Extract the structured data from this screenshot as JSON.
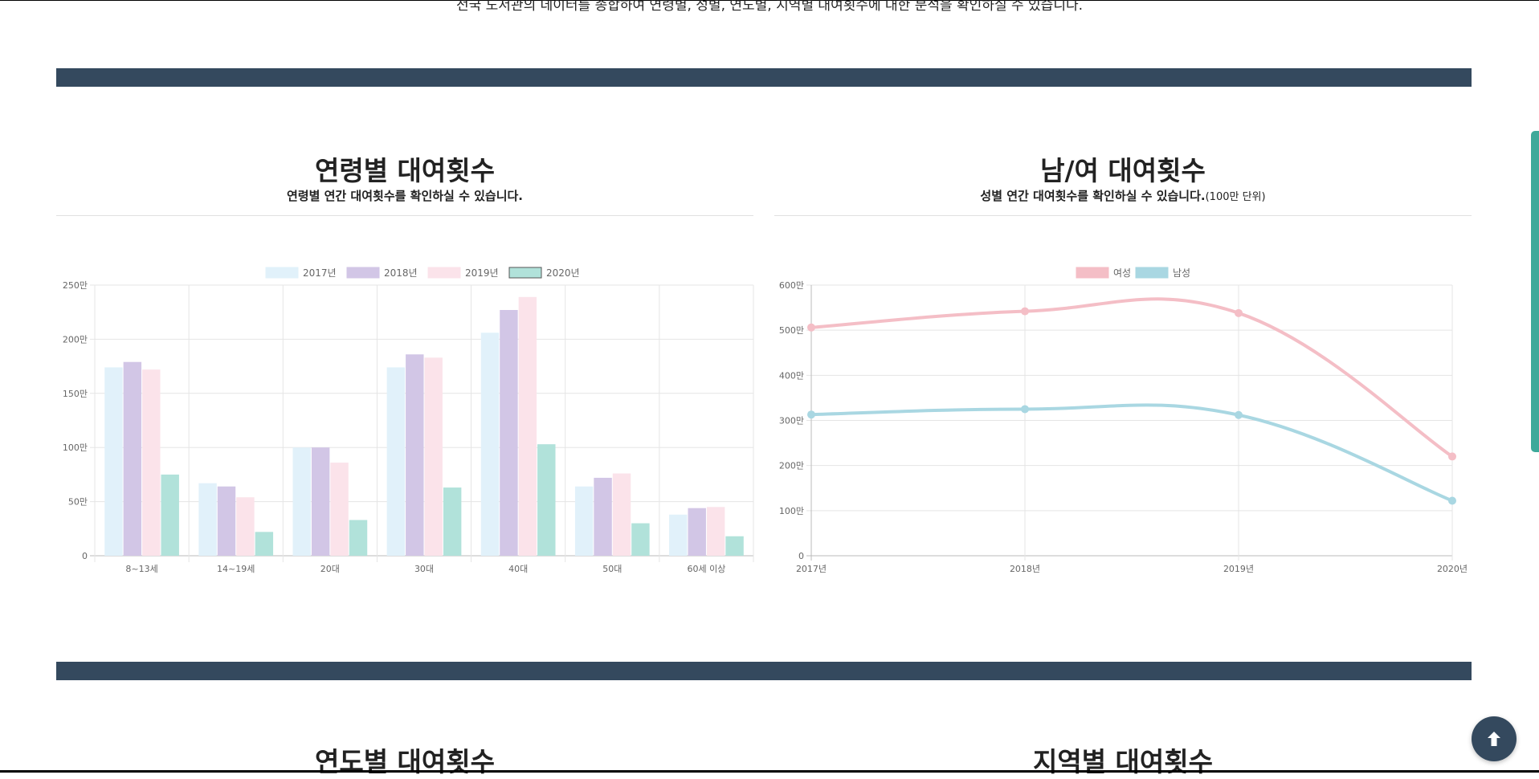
{
  "page": {
    "intro_text": "전국 도서관의 데이터를 종합하여 연령별, 성별, 연도별, 지역별 대여횟수에 대한 분석을 확인하실 수 있습니다."
  },
  "age_section": {
    "title": "연령별 대여횟수",
    "subtitle": "연령별 연간 대여횟수를 확인하실 수 있습니다."
  },
  "gender_section": {
    "title": "남/여 대여횟수",
    "subtitle": "성별 연간 대여횟수를 확인하실 수 있습니다.",
    "unit_note": "(100만 단위)"
  },
  "bottom_sections": {
    "left_title": "연도별 대여횟수",
    "right_title": "지역별 대여횟수"
  },
  "colors": {
    "band": "#34495e",
    "accent": "#3ea99a"
  },
  "icons": {
    "top_button": "arrow-up-icon"
  },
  "chart_data": [
    {
      "type": "bar",
      "categories": [
        "8~13세",
        "14~19세",
        "20대",
        "30대",
        "40대",
        "50대",
        "60세 이상"
      ],
      "series": [
        {
          "name": "2017년",
          "color": "#e1f1fa",
          "border": "#e1f1fa",
          "values": [
            1740000,
            670000,
            1000000,
            1740000,
            2060000,
            640000,
            380000
          ]
        },
        {
          "name": "2018년",
          "color": "#d2c6e6",
          "border": "#d2c6e6",
          "values": [
            1790000,
            640000,
            1000000,
            1860000,
            2270000,
            720000,
            440000
          ]
        },
        {
          "name": "2019년",
          "color": "#fbe3ea",
          "border": "#fbe3ea",
          "values": [
            1720000,
            540000,
            860000,
            1830000,
            2390000,
            760000,
            450000
          ]
        },
        {
          "name": "2020년",
          "color": "#b1e2da",
          "border": "#555555",
          "values": [
            750000,
            220000,
            330000,
            630000,
            1030000,
            300000,
            180000
          ]
        }
      ],
      "ylim": [
        0,
        2500000
      ],
      "yticks": [
        {
          "value": 0,
          "label": "0"
        },
        {
          "value": 500000,
          "label": "50만"
        },
        {
          "value": 1000000,
          "label": "100만"
        },
        {
          "value": 1500000,
          "label": "150만"
        },
        {
          "value": 2000000,
          "label": "200만"
        },
        {
          "value": 2500000,
          "label": "250만"
        }
      ],
      "grid": true,
      "legend": "top"
    },
    {
      "type": "line",
      "x": [
        "2017년",
        "2018년",
        "2019년",
        "2020년"
      ],
      "series": [
        {
          "name": "여성",
          "color": "#f4bec6",
          "values": [
            5060000,
            5420000,
            5380000,
            2200000
          ]
        },
        {
          "name": "남성",
          "color": "#a9d7e2",
          "values": [
            3130000,
            3250000,
            3120000,
            1220000
          ]
        }
      ],
      "ylim": [
        0,
        6000000
      ],
      "yticks": [
        {
          "value": 0,
          "label": "0"
        },
        {
          "value": 1000000,
          "label": "100만"
        },
        {
          "value": 2000000,
          "label": "200만"
        },
        {
          "value": 3000000,
          "label": "300만"
        },
        {
          "value": 4000000,
          "label": "400만"
        },
        {
          "value": 5000000,
          "label": "500만"
        },
        {
          "value": 6000000,
          "label": "600만"
        }
      ],
      "grid": true,
      "legend": "top"
    }
  ]
}
